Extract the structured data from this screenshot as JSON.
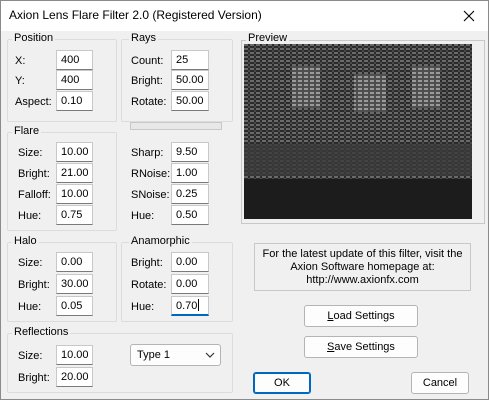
{
  "window": {
    "title": "Axion Lens Flare Filter 2.0 (Registered Version)"
  },
  "position": {
    "label": "Position",
    "x_label": "X:",
    "x_value": "400",
    "y_label": "Y:",
    "y_value": "400",
    "aspect_label": "Aspect:",
    "aspect_value": "0.10"
  },
  "rays": {
    "label": "Rays",
    "count_label": "Count:",
    "count_value": "25",
    "bright_label": "Bright:",
    "bright_value": "50.00",
    "rotate_label": "Rotate:",
    "rotate_value": "50.00"
  },
  "flare": {
    "label": "Flare",
    "size_label": "Size:",
    "size_value": "10.00",
    "bright_label": "Bright:",
    "bright_value": "21.00",
    "falloff_label": "Falloff:",
    "falloff_value": "10.00",
    "hue_label": "Hue:",
    "hue_value": "0.75"
  },
  "noise": {
    "sharp_label": "Sharp:",
    "sharp_value": "9.50",
    "rnoise_label": "RNoise:",
    "rnoise_value": "1.00",
    "snoise_label": "SNoise:",
    "snoise_value": "0.25",
    "hue_label": "Hue:",
    "hue_value": "0.50"
  },
  "halo": {
    "label": "Halo",
    "size_label": "Size:",
    "size_value": "0.00",
    "bright_label": "Bright:",
    "bright_value": "30.00",
    "hue_label": "Hue:",
    "hue_value": "0.05"
  },
  "anamorphic": {
    "label": "Anamorphic",
    "bright_label": "Bright:",
    "bright_value": "0.00",
    "rotate_label": "Rotate:",
    "rotate_value": "0.00",
    "hue_label": "Hue:",
    "hue_value": "0.70"
  },
  "reflections": {
    "label": "Reflections",
    "size_label": "Size:",
    "size_value": "10.00",
    "bright_label": "Bright:",
    "bright_value": "20.00",
    "type_value": "Type 1"
  },
  "preview": {
    "label": "Preview"
  },
  "info": {
    "line1": "For the latest update of this filter, visit the",
    "line2": "Axion Software homepage at:",
    "line3": "http://www.axionfx.com"
  },
  "buttons": {
    "load_first": "L",
    "load_rest": "oad Settings",
    "save_first": "S",
    "save_rest": "ave Settings",
    "ok": "OK",
    "cancel": "Cancel"
  },
  "colors": {
    "accent": "#0067c0",
    "preview_bg": "#1a1a1a"
  }
}
